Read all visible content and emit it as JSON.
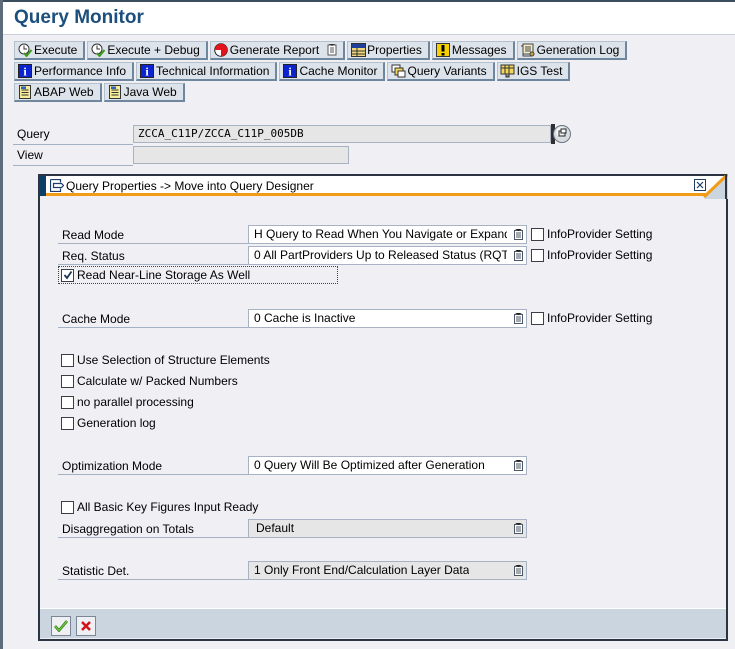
{
  "app": {
    "title": "Query Monitor"
  },
  "toolbar": {
    "rows": [
      [
        {
          "label": "Execute",
          "icon": "execute-icon"
        },
        {
          "label": "Execute + Debug",
          "icon": "execute-debug-icon"
        },
        {
          "label": "Generate Report",
          "icon": "generate-report-icon",
          "dropdown": true
        },
        {
          "label": "Properties",
          "icon": "properties-icon"
        },
        {
          "label": "Messages",
          "icon": "messages-icon"
        },
        {
          "label": "Generation Log",
          "icon": "generation-log-icon"
        }
      ],
      [
        {
          "label": "Performance Info",
          "icon": "info-icon"
        },
        {
          "label": "Technical Information",
          "icon": "info-icon"
        },
        {
          "label": "Cache Monitor",
          "icon": "info-icon"
        },
        {
          "label": "Query Variants",
          "icon": "query-variants-icon"
        },
        {
          "label": "IGS Test",
          "icon": "igs-test-icon"
        }
      ],
      [
        {
          "label": "ABAP Web",
          "icon": "web-document-icon"
        },
        {
          "label": "Java Web",
          "icon": "web-document-icon"
        }
      ]
    ]
  },
  "query_form": {
    "query_label": "Query",
    "query_value": "ZCCA_C11P/ZCCA_C11P_005DB",
    "view_label": "View",
    "view_value": ""
  },
  "dialog": {
    "title": "Query Properties -> Move into Query Designer",
    "read_mode": {
      "label": "Read Mode",
      "value": "H Query to Read When You Navigate or Expand",
      "infoprovider_label": "InfoProvider Setting",
      "infoprovider_checked": false
    },
    "req_status": {
      "label": "Req. Status",
      "value": "0 All PartProviders Up to Released Status (RQT",
      "infoprovider_label": "InfoProvider Setting",
      "infoprovider_checked": false
    },
    "near_line": {
      "label": "Read Near-Line Storage As Well",
      "checked": true
    },
    "cache_mode": {
      "label": "Cache Mode",
      "value": "0 Cache is Inactive",
      "infoprovider_label": "InfoProvider Setting",
      "infoprovider_checked": false
    },
    "options": [
      {
        "label": "Use Selection of Structure Elements",
        "checked": false
      },
      {
        "label": "Calculate w/ Packed Numbers",
        "checked": false
      },
      {
        "label": "no parallel processing",
        "checked": false
      },
      {
        "label": "Generation log",
        "checked": false
      }
    ],
    "optimization_mode": {
      "label": "Optimization Mode",
      "value": "0 Query Will Be Optimized after Generation"
    },
    "all_basic_kf": {
      "label": "All Basic Key Figures Input Ready",
      "checked": false
    },
    "disaggregation": {
      "label": "Disaggregation on Totals",
      "value": "Default"
    },
    "statistic_det": {
      "label": "Statistic Det.",
      "value": "1 Only Front End/Calculation Layer Data"
    },
    "footer": {
      "ok_icon": "checkmark-icon",
      "cancel_icon": "cancel-x-icon"
    }
  }
}
